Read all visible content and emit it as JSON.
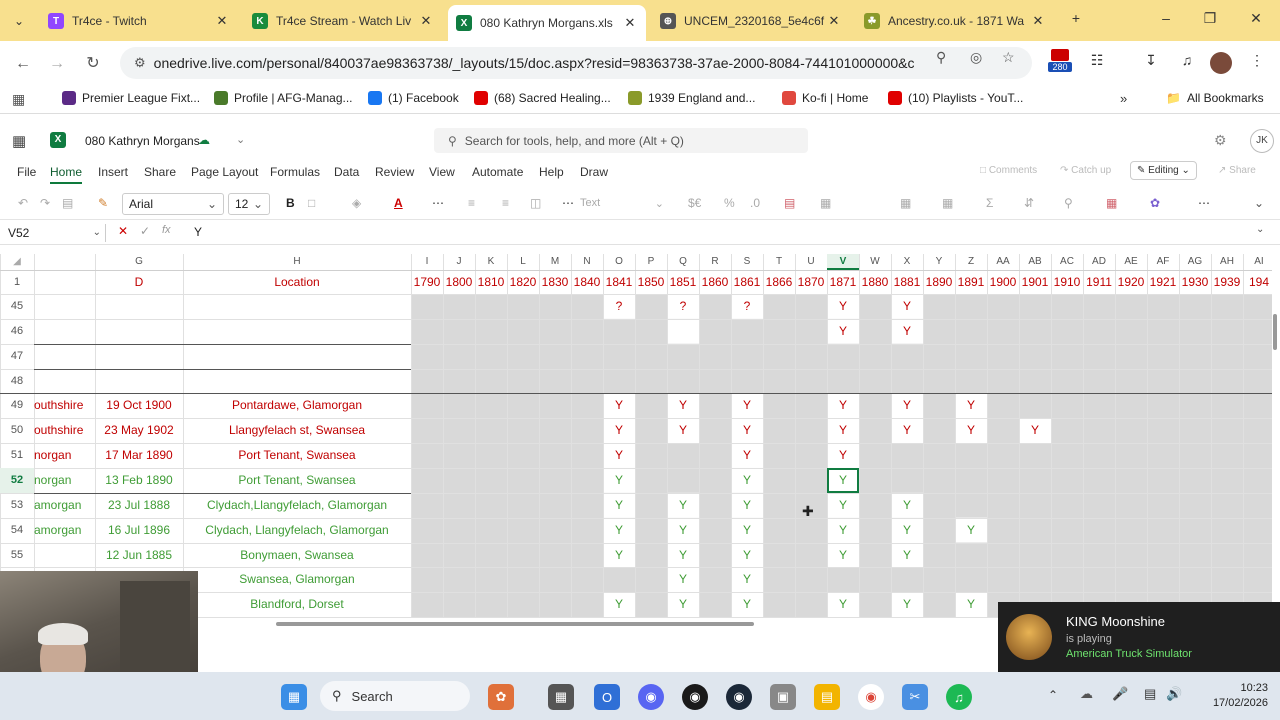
{
  "tabs": [
    {
      "title": "Tr4ce - Twitch",
      "color": "#9146ff",
      "glyph": "T"
    },
    {
      "title": "Tr4ce Stream - Watch Liv",
      "color": "#1a8c3c",
      "glyph": "K"
    },
    {
      "title": "080 Kathryn Morgans.xls",
      "color": "#107c41",
      "glyph": "X"
    },
    {
      "title": "UNCEM_2320168_5e4c6f",
      "color": "#555555",
      "glyph": "⊕"
    },
    {
      "title": "Ancestry.co.uk - 1871 Wa",
      "color": "#8a9a2a",
      "glyph": "☘"
    }
  ],
  "address": {
    "url": "onedrive.live.com/personal/840037ae98363738/_layouts/15/doc.aspx?resid=98363738-37ae-2000-8084-744101000000&ci...",
    "ext_badge": "280"
  },
  "bookmarks": [
    {
      "label": "Premier League Fixt...",
      "color": "#5b2a86"
    },
    {
      "label": "Profile | AFG-Manag...",
      "color": "#4a7a2a"
    },
    {
      "label": "(1) Facebook",
      "color": "#1877f2"
    },
    {
      "label": "(68) Sacred Healing...",
      "color": "#e00000"
    },
    {
      "label": "1939 England and...",
      "color": "#8a9a2a"
    },
    {
      "label": "Ko-fi | Home",
      "color": "#e0483e"
    },
    {
      "label": "(10) Playlists - YouT...",
      "color": "#e00000"
    }
  ],
  "all_bookmarks": "All Bookmarks",
  "excel": {
    "file_name": "080 Kathryn Morgans",
    "search_placeholder": "Search for tools, help, and more (Alt + Q)",
    "avatar": "JK",
    "ribbon_tabs": [
      "File",
      "Home",
      "Insert",
      "Share",
      "Page Layout",
      "Formulas",
      "Data",
      "Review",
      "View",
      "Automate",
      "Help",
      "Draw"
    ],
    "comments": "Comments",
    "catch_up": "Catch up",
    "editing": "Editing",
    "share": "Share",
    "font_name": "Arial",
    "font_size": "12",
    "number_format": "Text",
    "name_box": "V52",
    "formula_value": "Y"
  },
  "sheet": {
    "columns": [
      {
        "letter": "G",
        "header": "D"
      },
      {
        "letter": "H",
        "header": "Location"
      },
      {
        "letter": "I",
        "header": "1790"
      },
      {
        "letter": "J",
        "header": "1800"
      },
      {
        "letter": "K",
        "header": "1810"
      },
      {
        "letter": "L",
        "header": "1820"
      },
      {
        "letter": "M",
        "header": "1830"
      },
      {
        "letter": "N",
        "header": "1840"
      },
      {
        "letter": "O",
        "header": "1841"
      },
      {
        "letter": "P",
        "header": "1850"
      },
      {
        "letter": "Q",
        "header": "1851"
      },
      {
        "letter": "R",
        "header": "1860"
      },
      {
        "letter": "S",
        "header": "1861"
      },
      {
        "letter": "T",
        "header": "1866"
      },
      {
        "letter": "U",
        "header": "1870"
      },
      {
        "letter": "V",
        "header": "1871"
      },
      {
        "letter": "W",
        "header": "1880"
      },
      {
        "letter": "X",
        "header": "1881"
      },
      {
        "letter": "Y",
        "header": "1890"
      },
      {
        "letter": "Z",
        "header": "1891"
      },
      {
        "letter": "AA",
        "header": "1900"
      },
      {
        "letter": "AB",
        "header": "1901"
      },
      {
        "letter": "AC",
        "header": "1910"
      },
      {
        "letter": "AD",
        "header": "1911"
      },
      {
        "letter": "AE",
        "header": "1920"
      },
      {
        "letter": "AF",
        "header": "1921"
      },
      {
        "letter": "AG",
        "header": "1930"
      },
      {
        "letter": "AH",
        "header": "1939"
      },
      {
        "letter": "AI",
        "header": "194"
      }
    ],
    "rows": [
      {
        "num": "45",
        "color": "red",
        "F": "",
        "G": "",
        "H": "",
        "marks": {
          "O": "?",
          "Q": "?",
          "S": "?",
          "V": "Y",
          "X": "Y"
        }
      },
      {
        "num": "46",
        "color": "red",
        "F": "",
        "G": "",
        "H": "",
        "marks": {
          "V": "Y",
          "X": "Y"
        }
      },
      {
        "num": "47",
        "color": "red",
        "F": "",
        "G": "",
        "H": "",
        "marks": {}
      },
      {
        "num": "48",
        "color": "red",
        "F": "",
        "G": "",
        "H": "",
        "marks": {}
      },
      {
        "num": "49",
        "color": "red",
        "F": "outhshire",
        "G": "19 Oct 1900",
        "H": "Pontardawe, Glamorgan",
        "marks": {
          "O": "Y",
          "Q": "Y",
          "S": "Y",
          "V": "Y",
          "X": "Y",
          "Z": "Y"
        }
      },
      {
        "num": "50",
        "color": "red",
        "F": "outhshire",
        "G": "23 May 1902",
        "H": "Llangyfelach st, Swansea",
        "marks": {
          "O": "Y",
          "Q": "Y",
          "S": "Y",
          "V": "Y",
          "X": "Y",
          "Z": "Y",
          "AB": "Y"
        }
      },
      {
        "num": "51",
        "color": "red",
        "F": "norgan",
        "G": "17 Mar 1890",
        "H": "Port Tenant, Swansea",
        "marks": {
          "O": "Y",
          "S": "Y",
          "V": "Y"
        }
      },
      {
        "num": "52",
        "color": "green",
        "F": "norgan",
        "G": "13 Feb 1890",
        "H": "Port Tenant, Swansea",
        "marks": {
          "O": "Y",
          "S": "Y",
          "V": "Y"
        }
      },
      {
        "num": "53",
        "color": "green",
        "F": "amorgan",
        "G": "23 Jul 1888",
        "H": "Clydach,Llangyfelach, Glamorgan",
        "marks": {
          "O": "Y",
          "Q": "Y",
          "S": "Y",
          "V": "Y",
          "X": "Y"
        }
      },
      {
        "num": "54",
        "color": "green",
        "F": "amorgan",
        "G": "16 Jul 1896",
        "H": "Clydach, Llangyfelach, Glamorgan",
        "marks": {
          "O": "Y",
          "Q": "Y",
          "S": "Y",
          "V": "Y",
          "X": "Y",
          "Z": "Y"
        }
      },
      {
        "num": "55",
        "color": "green",
        "F": "",
        "G": "12 Jun 1885",
        "H": "Bonymaen, Swansea",
        "marks": {
          "O": "Y",
          "Q": "Y",
          "S": "Y",
          "V": "Y",
          "X": "Y"
        }
      },
      {
        "num": "",
        "color": "green",
        "F": "",
        "G": "",
        "H": "Swansea, Glamorgan",
        "marks": {
          "Q": "Y",
          "S": "Y"
        }
      },
      {
        "num": "",
        "color": "green",
        "F": "",
        "G": "",
        "H": "Blandford, Dorset",
        "marks": {
          "O": "Y",
          "Q": "Y",
          "S": "Y",
          "V": "Y",
          "X": "Y",
          "Z": "Y"
        }
      }
    ],
    "selected_row": "52",
    "selected_col": "V"
  },
  "notification": {
    "title": "KING Moonshine",
    "line2": "is playing",
    "line3": "American Truck Simulator"
  },
  "taskbar": {
    "search_label": "Search",
    "time": "10:23",
    "date": "17/02/2026"
  }
}
